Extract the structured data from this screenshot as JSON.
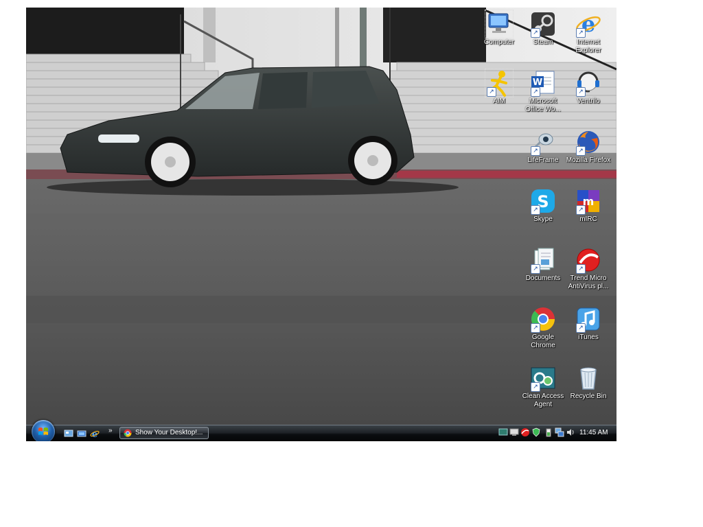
{
  "desktop": {
    "icons": [
      {
        "label": "Computer"
      },
      {
        "label": "Steam"
      },
      {
        "label": "Internet Explorer"
      },
      {
        "label": "AIM"
      },
      {
        "label": "Microsoft Office Wo..."
      },
      {
        "label": "Ventrilo"
      },
      {
        "label": "LifeFrame"
      },
      {
        "label": "Mozilla Firefox"
      },
      {
        "label": "Skype"
      },
      {
        "label": "mIRC"
      },
      {
        "label": "Documents"
      },
      {
        "label": "Trend Micro AntiVirus pl..."
      },
      {
        "label": "Google Chrome"
      },
      {
        "label": "iTunes"
      },
      {
        "label": "Clean Access Agent"
      },
      {
        "label": "Recycle Bin"
      }
    ]
  },
  "taskbar": {
    "chevron": "»",
    "task_button_label": "Show Your Desktop!...",
    "clock": "11:45 AM"
  },
  "colors": {
    "taskbar": "#1d2126",
    "label_text": "#ffffff"
  }
}
